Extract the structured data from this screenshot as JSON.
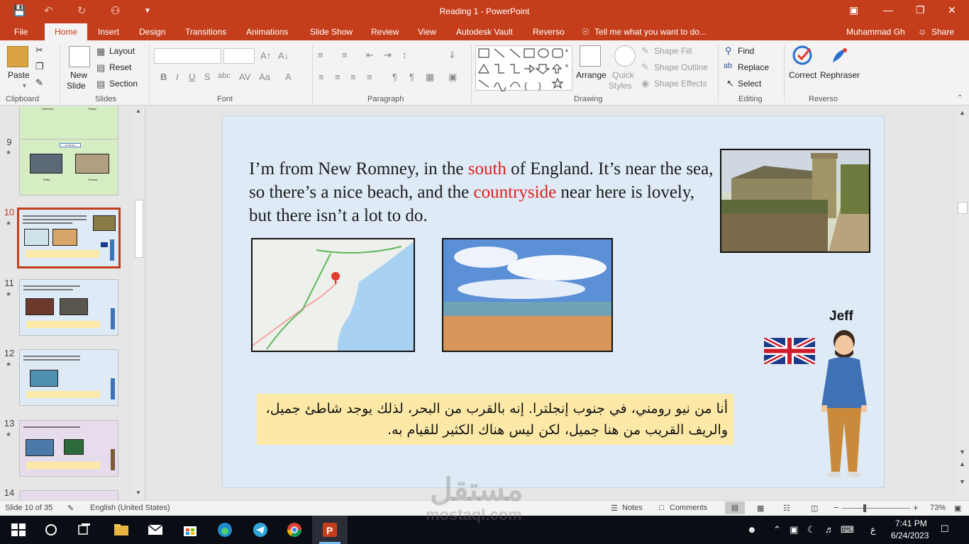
{
  "app": {
    "title": "Reading 1 - PowerPoint",
    "user": "Muhammad Gh",
    "share": "Share"
  },
  "tabs": [
    "File",
    "Home",
    "Insert",
    "Design",
    "Transitions",
    "Animations",
    "Slide Show",
    "Review",
    "View",
    "Autodesk Vault",
    "Reverso"
  ],
  "tell_me": "Tell me what you want to do...",
  "ribbon": {
    "clipboard": {
      "label": "Clipboard",
      "paste": "Paste"
    },
    "slides": {
      "label": "Slides",
      "new_slide_1": "New",
      "new_slide_2": "Slide",
      "layout": "Layout",
      "reset": "Reset",
      "section": "Section"
    },
    "font": {
      "label": "Font"
    },
    "paragraph": {
      "label": "Paragraph"
    },
    "drawing": {
      "label": "Drawing",
      "arrange": "Arrange",
      "quick_styles_1": "Quick",
      "quick_styles_2": "Styles",
      "shape_fill": "Shape Fill",
      "shape_outline": "Shape Outline",
      "shape_effects": "Shape Effects"
    },
    "editing": {
      "label": "Editing",
      "find": "Find",
      "replace": "Replace",
      "select": "Select"
    },
    "reverso": {
      "label": "Reverso",
      "correct": "Correct",
      "rephraser": "Rephraser"
    }
  },
  "thumbnails": [
    {
      "num": "9",
      "label_top": "Vocabulary",
      "cap1": "Traffic",
      "cap2": "Factory"
    },
    {
      "num": "10",
      "selected": true
    },
    {
      "num": "11"
    },
    {
      "num": "12"
    },
    {
      "num": "13"
    },
    {
      "num": "14"
    }
  ],
  "thumb_partial": {
    "cap1": "Cathedral",
    "cap2": "Palace"
  },
  "slide": {
    "t1": "I’m from New Romney, in the ",
    "t2": "south",
    "t3": " of England. It’s near the sea, so there’s a nice beach, and the ",
    "t4": "countryside",
    "t5": " near here is lovely, but there isn’t a lot to do.",
    "arabic": "أنا من نيو رومني، في جنوب إنجلترا. إنه بالقرب من البحر، لذلك يوجد شاطئ جميل، والريف القريب من هنا جميل، لكن ليس هناك الكثير للقيام به.",
    "person_name": "Jeff"
  },
  "status": {
    "slide": "Slide 10 of 35",
    "language": "English (United States)",
    "notes": "Notes",
    "comments": "Comments",
    "zoom": "73%"
  },
  "tray": {
    "time": "7:41 PM",
    "date": "6/24/2023",
    "lang": "ع"
  },
  "watermark": {
    "ar": "مستقل",
    "en": "mostaql.com"
  }
}
